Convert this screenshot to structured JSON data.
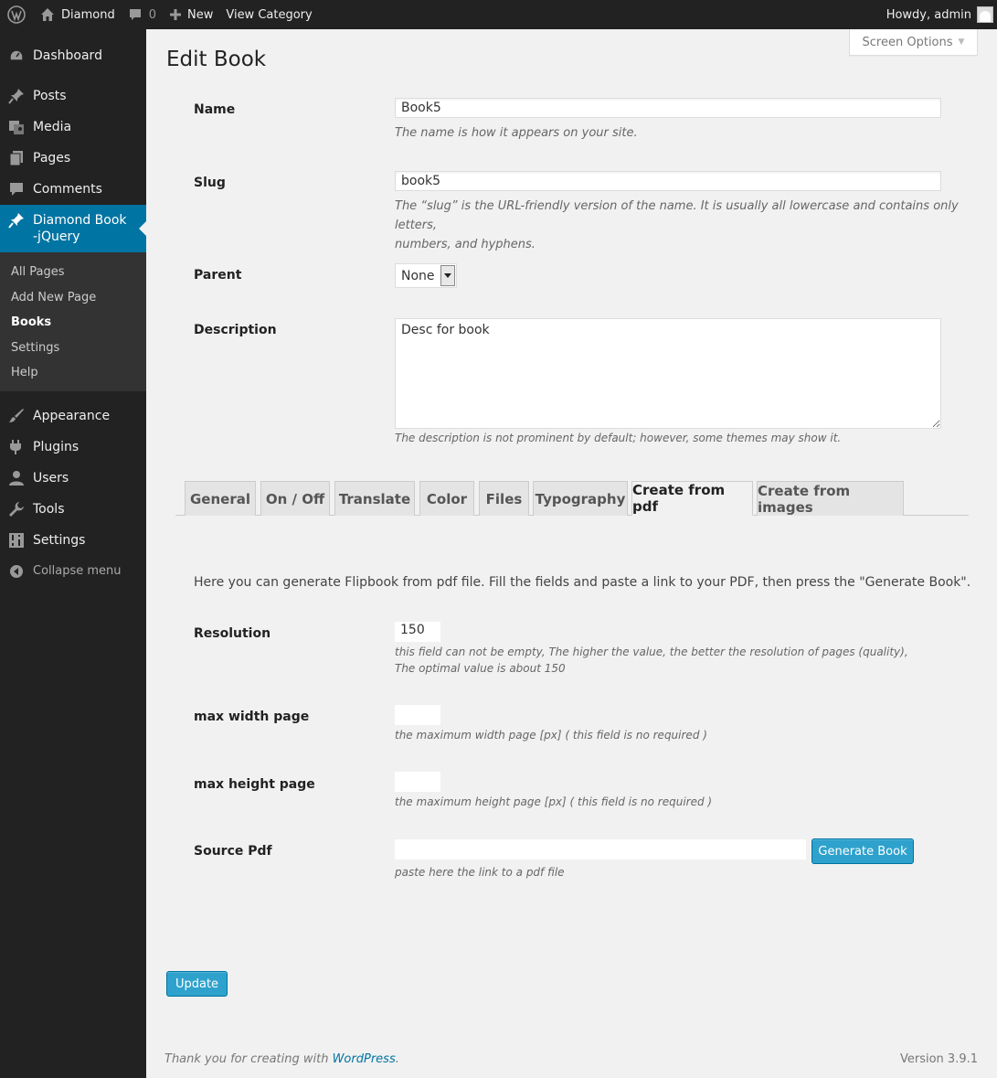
{
  "adminbar": {
    "site_name": "Diamond",
    "comments_count": "0",
    "new_label": "New",
    "view_category": "View Category",
    "howdy": "Howdy, admin"
  },
  "sidebar": {
    "items": [
      {
        "label": "Dashboard",
        "icon": "dashboard-icon"
      },
      {
        "label": "Posts",
        "icon": "pin-icon"
      },
      {
        "label": "Media",
        "icon": "media-icon"
      },
      {
        "label": "Pages",
        "icon": "pages-icon"
      },
      {
        "label": "Comments",
        "icon": "comment-icon"
      }
    ],
    "current": {
      "label_line1": "Diamond Book",
      "label_line2": "-jQuery"
    },
    "submenu": [
      "All Pages",
      "Add New Page",
      "Books",
      "Settings",
      "Help"
    ],
    "submenu_current": "Books",
    "items2": [
      {
        "label": "Appearance",
        "icon": "brush-icon"
      },
      {
        "label": "Plugins",
        "icon": "plugin-icon"
      },
      {
        "label": "Users",
        "icon": "user-icon"
      },
      {
        "label": "Tools",
        "icon": "wrench-icon"
      },
      {
        "label": "Settings",
        "icon": "settings-icon"
      }
    ],
    "collapse": "Collapse menu"
  },
  "screen_options": "Screen Options",
  "page_title": "Edit Book",
  "form": {
    "name_label": "Name",
    "name_value": "Book5",
    "name_desc": "The name is how it appears on your site.",
    "slug_label": "Slug",
    "slug_value": "book5",
    "slug_desc_1": "The “slug” is the URL-friendly version of the name. It is usually all lowercase and contains only letters,",
    "slug_desc_2": "numbers, and hyphens.",
    "parent_label": "Parent",
    "parent_value": "None",
    "description_label": "Description",
    "description_value": "Desc for book",
    "description_desc": "The description is not prominent by default; however, some themes may show it."
  },
  "tabs": [
    "General",
    "On / Off",
    "Translate",
    "Color",
    "Files",
    "Typography",
    "Create from pdf",
    "Create from images"
  ],
  "active_tab": "Create from pdf",
  "pdf": {
    "intro": "Here you can generate Flipbook from pdf file. Fill the fields and paste a link to your PDF, then press the \"Generate Book\".",
    "resolution_label": "Resolution",
    "resolution_value": "150",
    "resolution_desc_1": "this field can not be empty, The higher the value, the better the resolution of pages (quality),",
    "resolution_desc_2": "The optimal value is about 150",
    "max_width_label": "max width page",
    "max_width_desc": "the maximum width page [px] ( this field is no required )",
    "max_height_label": "max height page",
    "max_height_desc": "the maximum height page [px] ( this field is no required )",
    "source_label": "Source Pdf",
    "source_desc": "paste here the link to a pdf file",
    "generate_button": "Generate Book"
  },
  "update_button": "Update",
  "footer": {
    "thanks_prefix": "Thank you for creating with ",
    "wordpress_link": "WordPress",
    "thanks_suffix": ".",
    "version": "Version 3.9.1"
  },
  "colors": {
    "accent": "#0074a2",
    "button": "#2ea2cc",
    "sidebar": "#222222"
  }
}
